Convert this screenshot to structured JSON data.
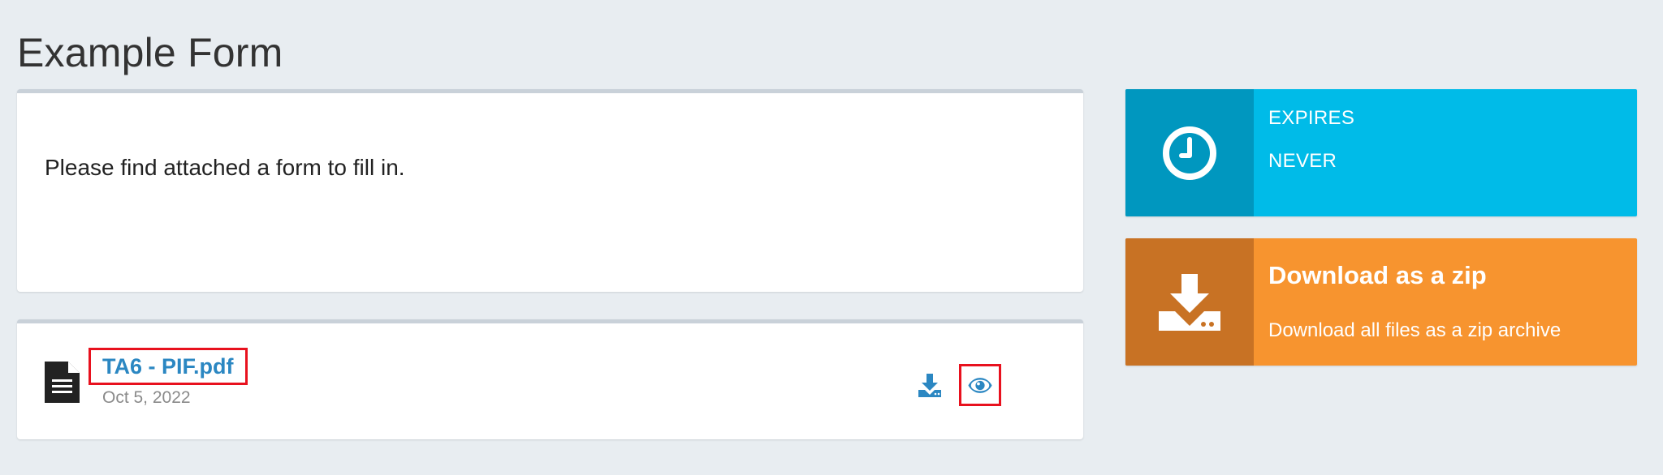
{
  "page": {
    "title": "Example Form"
  },
  "message": {
    "text": "Please find attached a form to fill in."
  },
  "file": {
    "name": "TA6 - PIF.pdf",
    "date": "Oct 5, 2022",
    "icons": {
      "file": "document-icon",
      "download": "download-icon",
      "view": "eye-icon"
    }
  },
  "expires": {
    "label": "EXPIRES",
    "value": "NEVER",
    "icon": "clock-icon"
  },
  "zip": {
    "title": "Download as a zip",
    "description": "Download all files as a zip archive",
    "icon": "download-tray-icon"
  },
  "colors": {
    "background": "#e8edf1",
    "link": "#2b87c2",
    "expires_main": "#00bbe8",
    "expires_dark": "#0097bf",
    "zip_main": "#f7942f",
    "zip_dark": "#c87224",
    "highlight": "#e8111e"
  }
}
